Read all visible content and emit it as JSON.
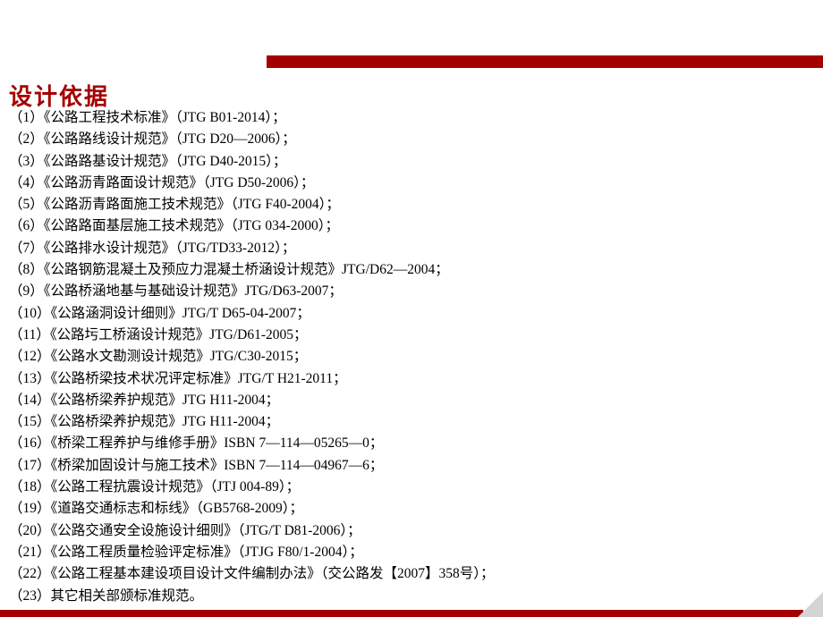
{
  "title": "设计依据",
  "items": [
    "（1）《公路工程技术标准》（JTG B01-2014）；",
    "（2）《公路路线设计规范》（JTG D20—2006）；",
    "（3）《公路路基设计规范》（JTG D40-2015）；",
    "（4）《公路沥青路面设计规范》（JTG D50-2006）；",
    "（5）《公路沥青路面施工技术规范》（JTG F40-2004）；",
    "（6）《公路路面基层施工技术规范》（JTG 034-2000）；",
    "（7）《公路排水设计规范》（JTG/TD33-2012）；",
    "（8）《公路钢筋混凝土及预应力混凝土桥涵设计规范》JTG/D62—2004；",
    "（9）《公路桥涵地基与基础设计规范》JTG/D63-2007；",
    "（10）《公路涵洞设计细则》JTG/T D65-04-2007；",
    "（11）《公路圬工桥涵设计规范》JTG/D61-2005；",
    "（12）《公路水文勘测设计规范》JTG/C30-2015；",
    "（13）《公路桥梁技术状况评定标准》JTG/T H21-2011；",
    "（14）《公路桥梁养护规范》JTG H11-2004；",
    "（15）《公路桥梁养护规范》JTG H11-2004；",
    "（16）《桥梁工程养护与维修手册》ISBN 7—114—05265—0；",
    "（17）《桥梁加固设计与施工技术》ISBN 7—114—04967—6；",
    "（18）《公路工程抗震设计规范》（JTJ 004-89）；",
    "（19）《道路交通标志和标线》（GB5768-2009）；",
    "（20）《公路交通安全设施设计细则》（JTG/T D81-2006）；",
    "（21）《公路工程质量检验评定标准》（JTJG F80/1-2004）；",
    "（22）《公路工程基本建设项目设计文件编制办法》（交公路发【2007】358号）；",
    "（23）其它相关部颁标准规范。"
  ]
}
